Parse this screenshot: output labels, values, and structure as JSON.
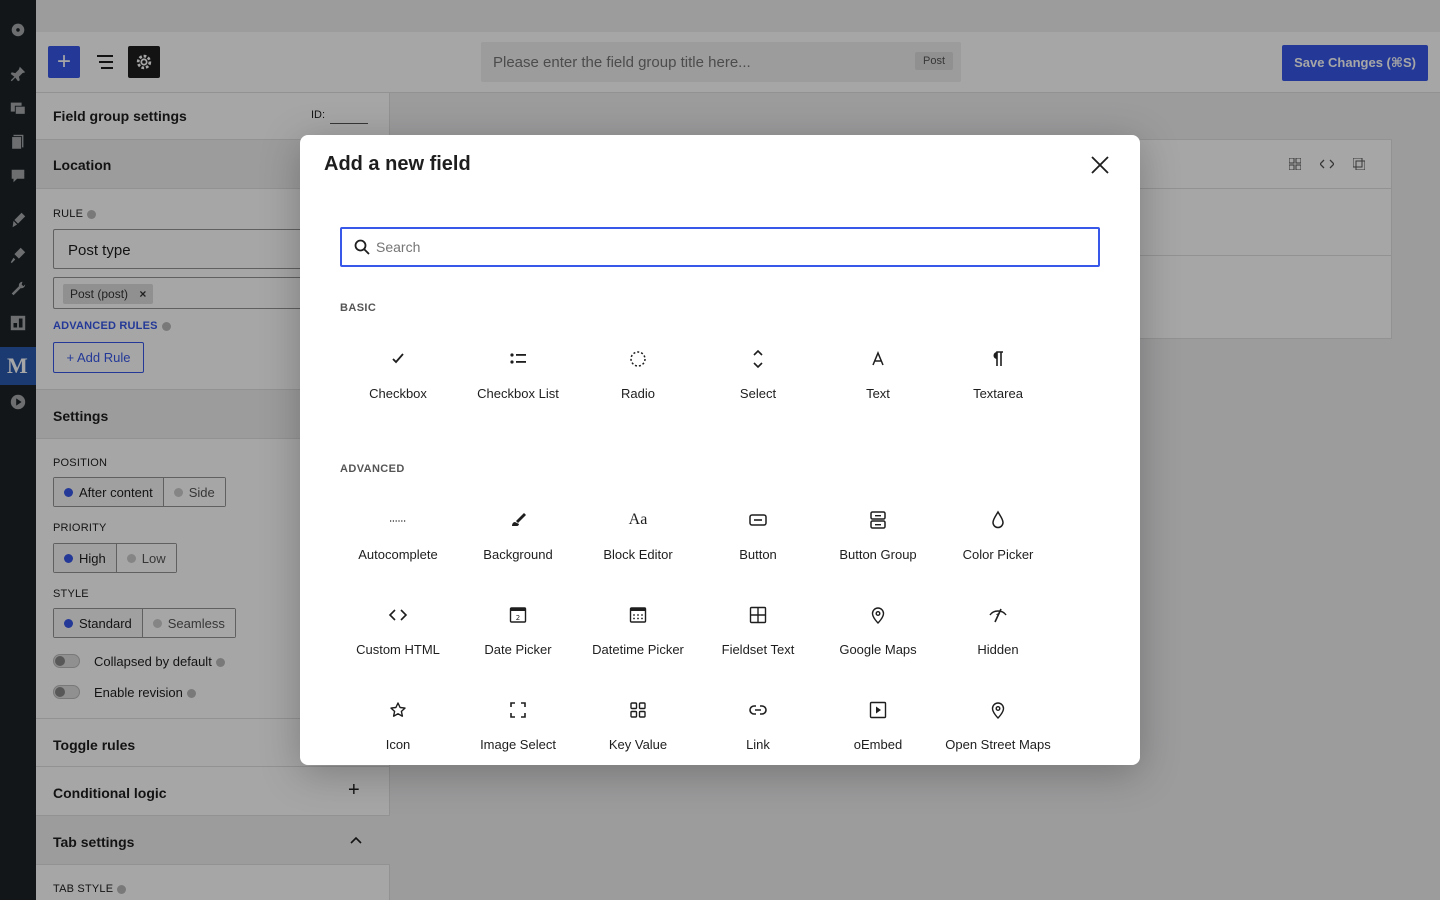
{
  "topbar": {
    "title_placeholder": "Please enter the field group title here...",
    "post_badge": "Post",
    "save_label": "Save Changes (⌘S)"
  },
  "panel": {
    "header": "Field group settings",
    "id_label": "ID:",
    "location": "Location",
    "rule_label": "RULE",
    "rule_value": "Post type",
    "tag_value": "Post (post)",
    "tag_remove": "×",
    "advanced_rules": "ADVANCED RULES",
    "add_rule": "+ Add Rule",
    "settings": "Settings",
    "position_label": "POSITION",
    "position_options": [
      "After content",
      "Side"
    ],
    "priority_label": "PRIORITY",
    "priority_options": [
      "High",
      "Low"
    ],
    "style_label": "STYLE",
    "style_options": [
      "Standard",
      "Seamless"
    ],
    "collapsed": "Collapsed by default",
    "revision": "Enable revision",
    "toggle_rules": "Toggle rules",
    "conditional_logic": "Conditional logic",
    "tab_settings": "Tab settings",
    "tab_style": "TAB STYLE"
  },
  "modal": {
    "title": "Add a new field",
    "search_placeholder": "Search",
    "basic_title": "BASIC",
    "basic": [
      {
        "name": "Checkbox",
        "icon": "check-icon"
      },
      {
        "name": "Checkbox List",
        "icon": "list-bullet-icon"
      },
      {
        "name": "Radio",
        "icon": "radio-circle-icon"
      },
      {
        "name": "Select",
        "icon": "chevron-up-down-icon"
      },
      {
        "name": "Text",
        "icon": "text-a-icon"
      },
      {
        "name": "Textarea",
        "icon": "pilcrow-icon"
      }
    ],
    "advanced_title": "ADVANCED",
    "advanced": [
      {
        "name": "Autocomplete",
        "icon": "dots-icon"
      },
      {
        "name": "Background",
        "icon": "brush-icon"
      },
      {
        "name": "Block Editor",
        "icon": "font-aa-icon"
      },
      {
        "name": "Button",
        "icon": "button-icon"
      },
      {
        "name": "Button Group",
        "icon": "button-group-icon"
      },
      {
        "name": "Color Picker",
        "icon": "droplet-icon"
      },
      {
        "name": "Custom HTML",
        "icon": "code-icon"
      },
      {
        "name": "Date Picker",
        "icon": "calendar-icon"
      },
      {
        "name": "Datetime Picker",
        "icon": "calendar-grid-icon"
      },
      {
        "name": "Fieldset Text",
        "icon": "table-icon"
      },
      {
        "name": "Google Maps",
        "icon": "map-pin-icon"
      },
      {
        "name": "Hidden",
        "icon": "eye-slash-icon"
      },
      {
        "name": "Icon",
        "icon": "star-icon"
      },
      {
        "name": "Image Select",
        "icon": "frame-icon"
      },
      {
        "name": "Key Value",
        "icon": "grid-icon"
      },
      {
        "name": "Link",
        "icon": "link-icon"
      },
      {
        "name": "oEmbed",
        "icon": "video-icon"
      },
      {
        "name": "Open Street Maps",
        "icon": "map-pin-icon"
      }
    ]
  }
}
